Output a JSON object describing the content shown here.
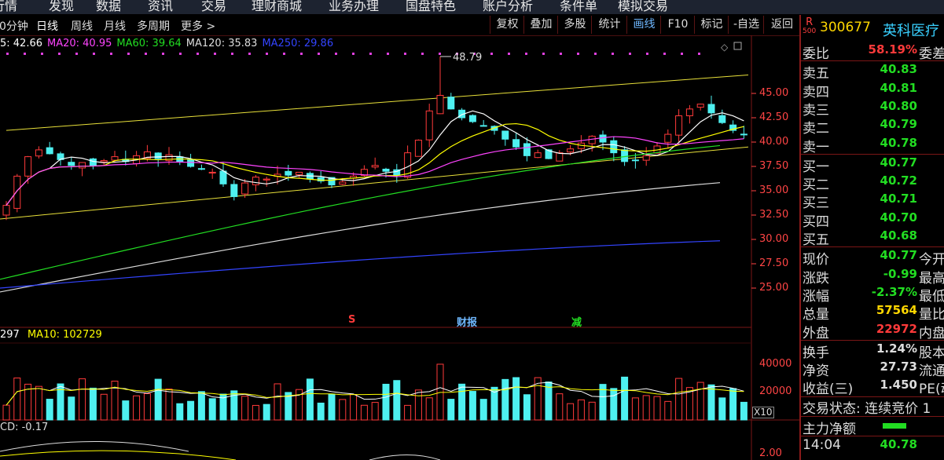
{
  "top_menu": [
    "行情",
    "发现",
    "数据",
    "资讯",
    "交易",
    "理财商城",
    "业务办理",
    "国盘特色",
    "账户分析",
    "条件单",
    "模拟交易"
  ],
  "periods": [
    "分钟",
    "日线",
    "周线",
    "月线",
    "多周期",
    "更多 >"
  ],
  "active_period": "日线",
  "toolbar": [
    "复权",
    "叠加",
    "多股",
    "统计",
    "画线",
    "F10",
    "标记",
    "-自选",
    "返回"
  ],
  "active_tool": "画线",
  "ma_legend": [
    {
      "text": "5: 42.66",
      "color": "#ffffff"
    },
    {
      "text": "MA20: 40.95",
      "color": "#ff44ff"
    },
    {
      "text": "MA60: 39.64",
      "color": "#22dd22"
    },
    {
      "text": "MA120: 35.83",
      "color": "#dddddd"
    },
    {
      "text": "MA250: 29.86",
      "color": "#3344ff"
    }
  ],
  "price_axis": [
    "45.00",
    "42.50",
    "40.00",
    "37.50",
    "35.00",
    "32.50",
    "30.00",
    "27.50",
    "25.00"
  ],
  "high_marker": "48.79",
  "event_markers": [
    {
      "text": "S",
      "color": "#ff3a3a"
    },
    {
      "text": "财报",
      "color": "#6fb8ff"
    },
    {
      "text": "减",
      "color": "#22dd22"
    }
  ],
  "volume_legend": {
    "vol": "297",
    "ma10": "MA10: 102729"
  },
  "volume_axis": [
    "40000",
    "20000"
  ],
  "volume_unit": "X10",
  "macd_legend": "CD: -0.17",
  "macd_axis": "2.00",
  "stock": {
    "market_tag_r": "R",
    "market_tag_num": "500",
    "code": "300677",
    "name": "英科医疗"
  },
  "weibi": {
    "label": "委比",
    "value": "58.19%",
    "label2": "委差"
  },
  "sell": [
    {
      "label": "卖五",
      "price": "40.83"
    },
    {
      "label": "卖四",
      "price": "40.81"
    },
    {
      "label": "卖三",
      "price": "40.80"
    },
    {
      "label": "卖二",
      "price": "40.79"
    },
    {
      "label": "卖一",
      "price": "40.78"
    }
  ],
  "buy": [
    {
      "label": "买一",
      "price": "40.77"
    },
    {
      "label": "买二",
      "price": "40.72"
    },
    {
      "label": "买三",
      "price": "40.71"
    },
    {
      "label": "买四",
      "price": "40.70"
    },
    {
      "label": "买五",
      "price": "40.68"
    }
  ],
  "quote": [
    {
      "label": "现价",
      "value": "40.77",
      "label2": "今开",
      "color": "#22dd22"
    },
    {
      "label": "涨跌",
      "value": "-0.99",
      "label2": "最高",
      "color": "#22dd22"
    },
    {
      "label": "涨幅",
      "value": "-2.37%",
      "label2": "最低",
      "color": "#22dd22"
    },
    {
      "label": "总量",
      "value": "57564",
      "label2": "量比",
      "color": "#ffd700"
    },
    {
      "label": "外盘",
      "value": "22972",
      "label2": "内盘",
      "color": "#ff3a3a"
    }
  ],
  "fund": [
    {
      "label": "换手",
      "value": "1.24%",
      "label2": "股本"
    },
    {
      "label": "净资",
      "value": "27.73",
      "label2": "流通"
    },
    {
      "label": "收益(三)",
      "value": "1.450",
      "label2": "PE(动"
    }
  ],
  "trade_status": "交易状态: 连续竞价 1",
  "main_net": "主力净额",
  "bottom_time": "14:04",
  "bottom_price": "40.78",
  "colors": {
    "up": "#ff3a3a",
    "down": "#4ef0f0",
    "ma5": "#ffffff",
    "ma10": "#ffff00",
    "ma20": "#ff44ff",
    "ma60": "#22dd22",
    "ma120": "#dddddd",
    "ma250": "#3344ff"
  }
}
